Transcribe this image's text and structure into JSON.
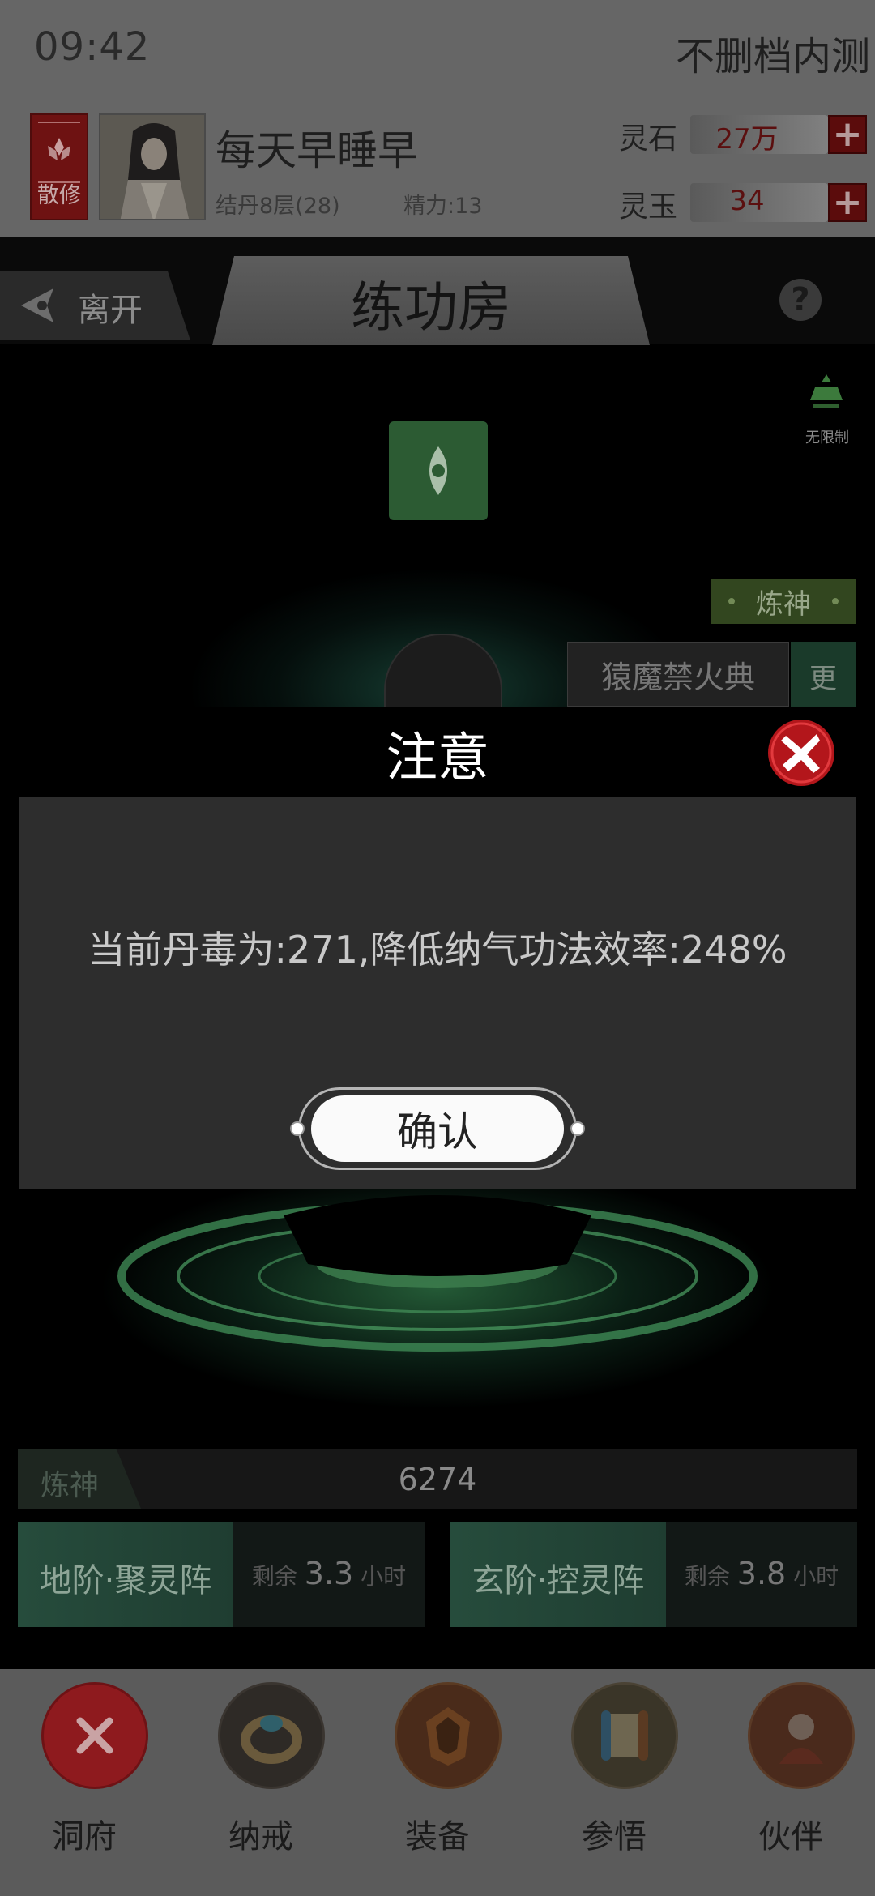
{
  "status_bar": {
    "time": "09:42",
    "server": "不删档内测"
  },
  "player": {
    "sect": "散修",
    "name": "每天早睡早",
    "realm": "结丹8层(28)",
    "energy": "精力:13"
  },
  "currency": {
    "lingshi": {
      "label": "灵石",
      "value": "27万"
    },
    "lingyu": {
      "label": "灵玉",
      "value": "34"
    }
  },
  "header": {
    "back_label": "离开",
    "title": "练功房",
    "help_icon": "question-icon"
  },
  "scene": {
    "no_limit_label": "无限制",
    "cultivation_tag": "炼神",
    "technique_name": "猿魔禁火典",
    "more_tab": "更"
  },
  "dialog": {
    "title": "注意",
    "message": "当前丹毒为:271,降低纳气功法效率:248%",
    "confirm_label": "确认"
  },
  "stats": {
    "label": "炼神",
    "value": "6274"
  },
  "arrays": [
    {
      "name": "地阶·聚灵阵",
      "remain_prefix": "剩余",
      "remain_value": "3.3",
      "remain_unit": "小时"
    },
    {
      "name": "玄阶·控灵阵",
      "remain_prefix": "剩余",
      "remain_value": "3.8",
      "remain_unit": "小时"
    }
  ],
  "nav": [
    {
      "label": "洞府",
      "icon": "close-icon"
    },
    {
      "label": "纳戒",
      "icon": "ring-icon"
    },
    {
      "label": "装备",
      "icon": "armor-icon"
    },
    {
      "label": "参悟",
      "icon": "scroll-icon"
    },
    {
      "label": "伙伴",
      "icon": "companion-icon"
    }
  ],
  "colors": {
    "accent_red": "#b3161b",
    "accent_green": "#2c5b33",
    "dialog_bg": "#2d2d2d"
  }
}
